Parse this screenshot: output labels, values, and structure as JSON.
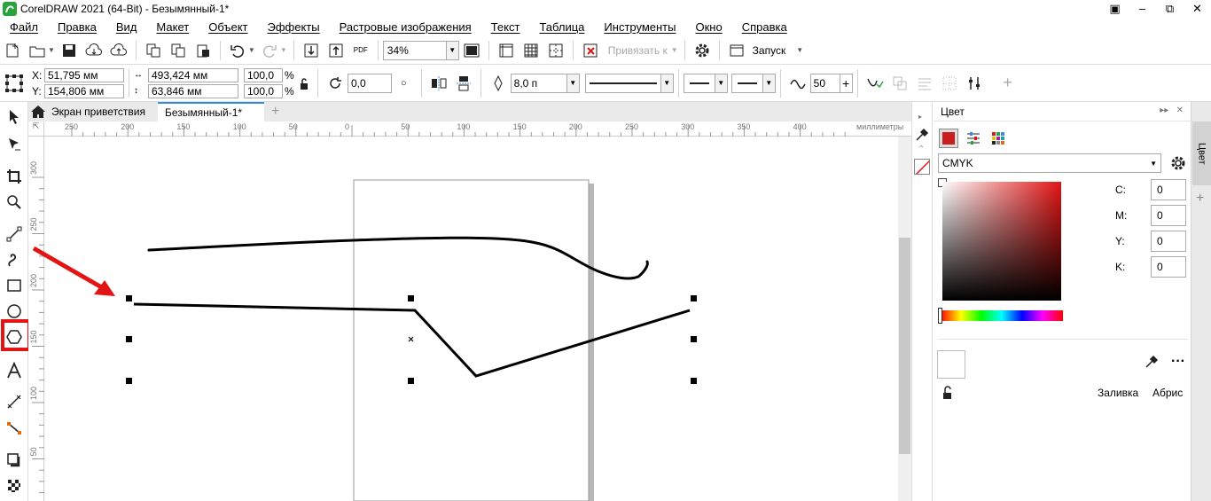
{
  "window": {
    "title": "CorelDRAW 2021 (64-Bit) - Безымянный-1*",
    "controls": [
      "–",
      "⧉",
      "✕"
    ]
  },
  "menu": [
    "Файл",
    "Правка",
    "Вид",
    "Макет",
    "Объект",
    "Эффекты",
    "Растровые изображения",
    "Текст",
    "Таблица",
    "Инструменты",
    "Окно",
    "Справка"
  ],
  "standard_toolbar": {
    "zoom_value": "34%",
    "snap_label": "Привязать к",
    "launch_label": "Запуск",
    "pdf_label": "PDF"
  },
  "property_bar": {
    "x_label": "X:",
    "x_value": "51,795 мм",
    "y_label": "Y:",
    "y_value": "154,806 мм",
    "width_value": "493,424 мм",
    "height_value": "63,846 мм",
    "scale_x": "100,0",
    "scale_y": "100,0",
    "percent": "%",
    "rotation": "0,0",
    "outline_width": "8,0 п",
    "smoothing": "50"
  },
  "document_tabs": {
    "welcome": "Экран приветствия",
    "current": "Безымянный-1*",
    "add": "+"
  },
  "rulers": {
    "h_labels": [
      "250",
      "200",
      "150",
      "100",
      "50",
      "0",
      "50",
      "100",
      "150",
      "200",
      "250",
      "300",
      "350",
      "400"
    ],
    "units": "миллиметры",
    "v_labels": [
      "300",
      "250",
      "200",
      "150",
      "100",
      "50"
    ]
  },
  "docker": {
    "title": "Цвет",
    "model": "CMYK",
    "c_label": "C:",
    "c_value": "0",
    "m_label": "M:",
    "m_value": "0",
    "y_label": "Y:",
    "y_value": "0",
    "k_label": "K:",
    "k_value": "0",
    "fill_label": "Заливка",
    "outline_label": "Абрис"
  },
  "side_tab": "Цвет",
  "colors": {
    "highlight": "#e31414",
    "accent": "#3b8be0"
  }
}
